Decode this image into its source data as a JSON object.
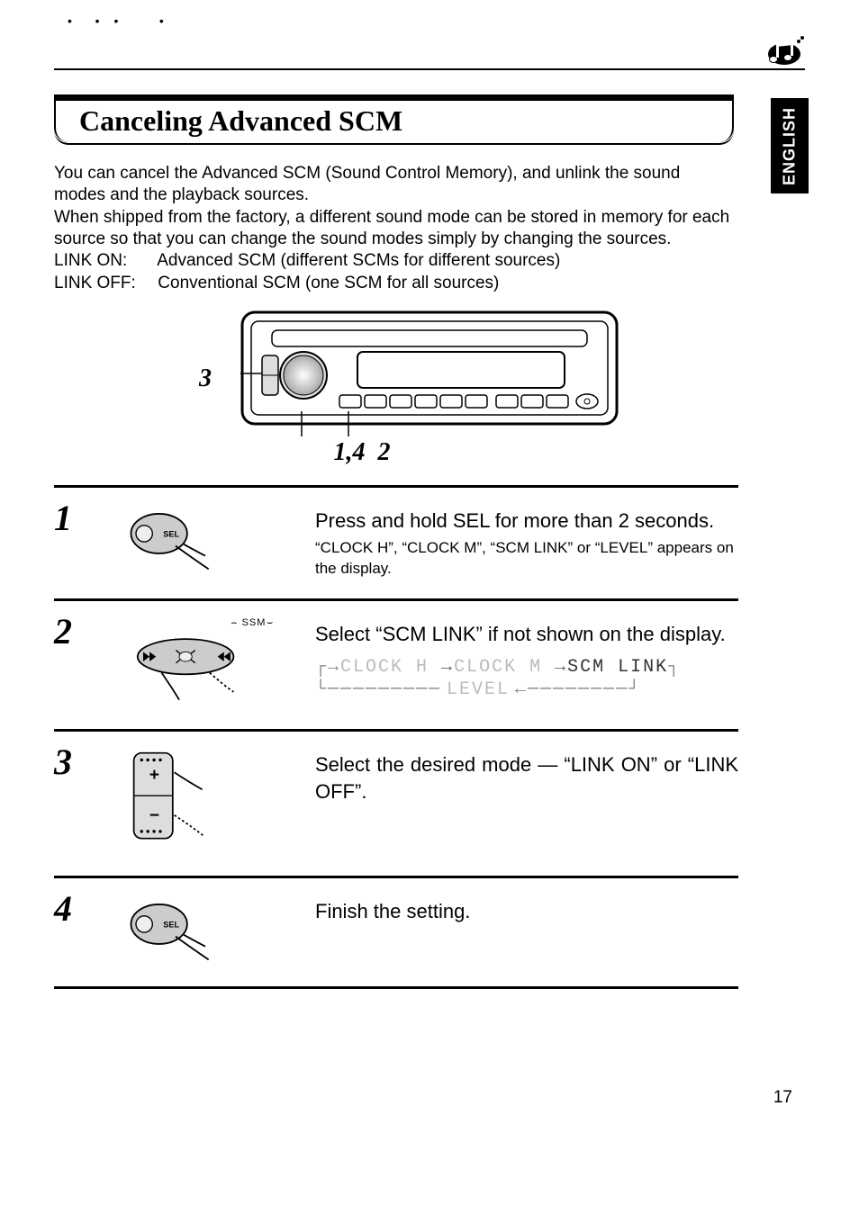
{
  "language_tab": "ENGLISH",
  "heading": "Canceling Advanced SCM",
  "intro": {
    "p1": "You can cancel the Advanced SCM (Sound Control Memory), and unlink the sound modes and the playback sources.",
    "p2": "When shipped from the factory, a different sound mode can be stored in memory for each source so that you can change the sound modes simply by changing the sources.",
    "link_on_label": "LINK ON:",
    "link_on_text": "Advanced SCM (different SCMs for different sources)",
    "link_off_label": "LINK OFF:",
    "link_off_text": "Conventional SCM (one SCM for all sources)"
  },
  "figure": {
    "callout_left": "3",
    "callout_bottom": "1,4  2"
  },
  "steps": [
    {
      "num": "1",
      "icon": "sel-button",
      "button_label": "SEL",
      "title": "Press and hold SEL for more than 2 seconds.",
      "sub": "“CLOCK H”, “CLOCK M”, “SCM LINK” or “LEVEL” appears on the display."
    },
    {
      "num": "2",
      "icon": "track-buttons",
      "ssm_label": "SSM",
      "title": "Select “SCM LINK” if not shown on the display.",
      "cycle": {
        "items": [
          "CLOCK H",
          "CLOCK M",
          "SCM LINK"
        ],
        "bottom": "LEVEL"
      }
    },
    {
      "num": "3",
      "icon": "plus-minus-buttons",
      "title": "Select the desired mode — “LINK ON” or “LINK OFF”."
    },
    {
      "num": "4",
      "icon": "sel-button",
      "button_label": "SEL",
      "title": "Finish the setting."
    }
  ],
  "page_number": "17"
}
